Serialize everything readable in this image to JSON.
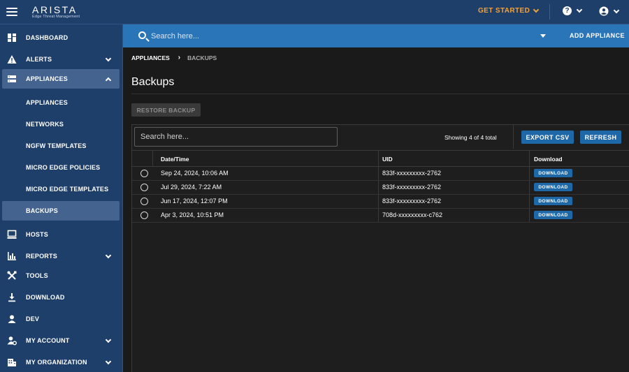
{
  "brand": {
    "name": "ARISTA",
    "tagline": "Edge Threat Management"
  },
  "topbar": {
    "get_started": "GET STARTED"
  },
  "search": {
    "placeholder": "Search here...",
    "add_appliance": "ADD APPLIANCE"
  },
  "sidebar": {
    "items": [
      {
        "label": "DASHBOARD"
      },
      {
        "label": "ALERTS"
      },
      {
        "label": "APPLIANCES"
      },
      {
        "label": "HOSTS"
      },
      {
        "label": "REPORTS"
      },
      {
        "label": "TOOLS"
      },
      {
        "label": "DOWNLOAD"
      },
      {
        "label": "DEV"
      },
      {
        "label": "MY ACCOUNT"
      },
      {
        "label": "MY ORGANIZATION"
      }
    ],
    "sub_items": [
      {
        "label": "APPLIANCES"
      },
      {
        "label": "NETWORKS"
      },
      {
        "label": "NGFW TEMPLATES"
      },
      {
        "label": "MICRO EDGE POLICIES"
      },
      {
        "label": "MICRO EDGE TEMPLATES"
      },
      {
        "label": "BACKUPS"
      }
    ]
  },
  "breadcrumb": {
    "parent": "APPLIANCES",
    "current": "BACKUPS"
  },
  "page": {
    "title": "Backups",
    "restore_label": "RESTORE BACKUP"
  },
  "grid": {
    "search_placeholder": "Search here...",
    "showing": "Showing 4 of 4 total",
    "export_label": "EXPORT CSV",
    "refresh_label": "REFRESH",
    "columns": [
      "Date/Time",
      "UID",
      "Download"
    ],
    "rows": [
      {
        "datetime": "Sep 24, 2024, 10:06 AM",
        "uid": "833f-xxxxxxxxx-2762",
        "download": "DOWNLOAD"
      },
      {
        "datetime": "Jul 29, 2024, 7:22 AM",
        "uid": "833f-xxxxxxxxx-2762",
        "download": "DOWNLOAD"
      },
      {
        "datetime": "Jun 17, 2024, 12:07 PM",
        "uid": "833f-xxxxxxxxx-2762",
        "download": "DOWNLOAD"
      },
      {
        "datetime": "Apr 3, 2024, 10:51 PM",
        "uid": "708d-xxxxxxxxx-c762",
        "download": "DOWNLOAD"
      }
    ]
  },
  "colors": {
    "nav_bg": "#1f3f6b",
    "accent_blue": "#2a74b8",
    "button_blue": "#1f68a8",
    "get_started": "#f0a23b",
    "content_bg": "#1a1a1a"
  }
}
